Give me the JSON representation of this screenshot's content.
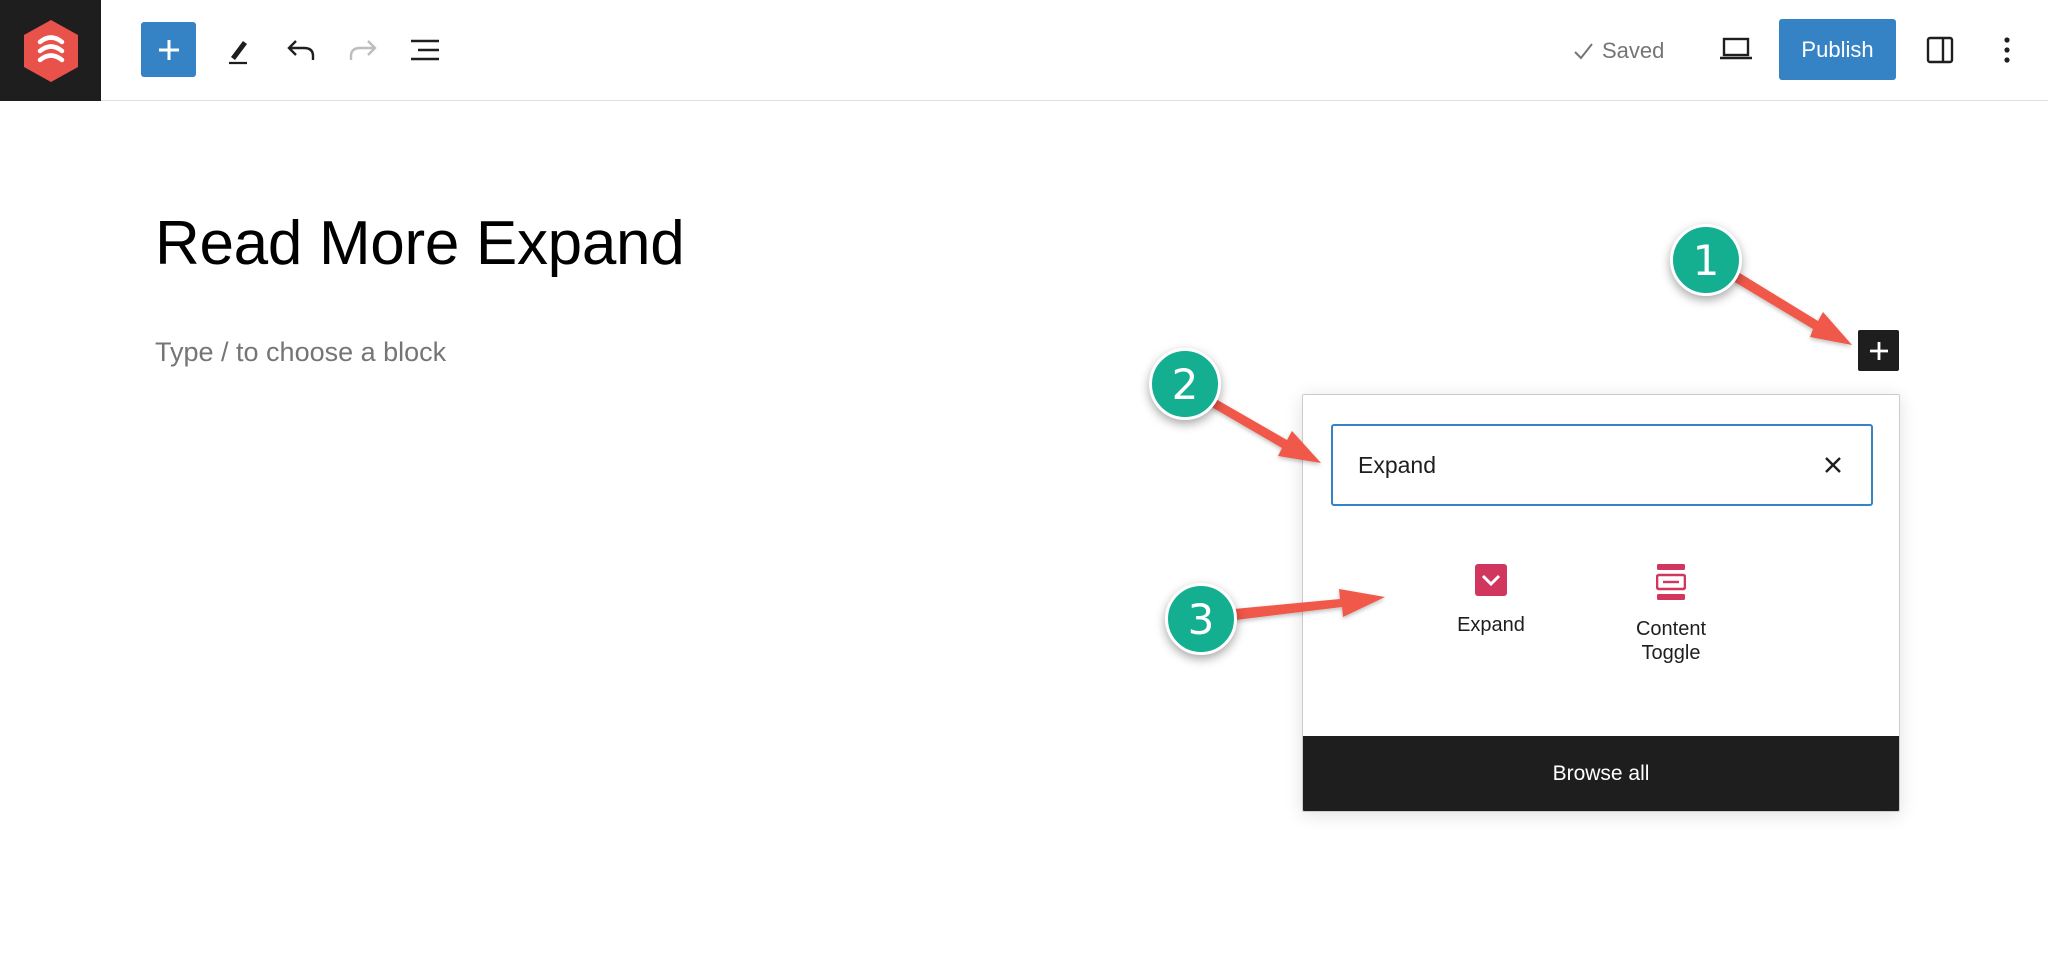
{
  "toolbar": {
    "site_logo": "site-logo-icon",
    "add_block_icon": "plus-icon",
    "tools_icon": "pencil-icon",
    "undo_icon": "undo-icon",
    "redo_icon": "redo-icon",
    "list_view_icon": "list-view-icon",
    "saved_label": "Saved",
    "preview_icon": "laptop-icon",
    "publish_label": "Publish",
    "settings_icon": "sidebar-icon",
    "options_icon": "more-vertical-icon",
    "accent_color": "#3582c4"
  },
  "editor": {
    "title": "Read More Expand",
    "placeholder": "Type / to choose a block"
  },
  "inserter": {
    "search_value": "Expand",
    "blocks": [
      {
        "label": "Expand",
        "icon": "chevron-down-box-icon"
      },
      {
        "label": "Content\nToggle",
        "icon": "content-toggle-icon"
      }
    ],
    "browse_all_label": "Browse all",
    "block_icon_color": "#d0365e"
  },
  "annotations": {
    "badges": [
      "1",
      "2",
      "3"
    ],
    "badge_color": "#14ae90",
    "arrow_color": "#f0584a"
  }
}
